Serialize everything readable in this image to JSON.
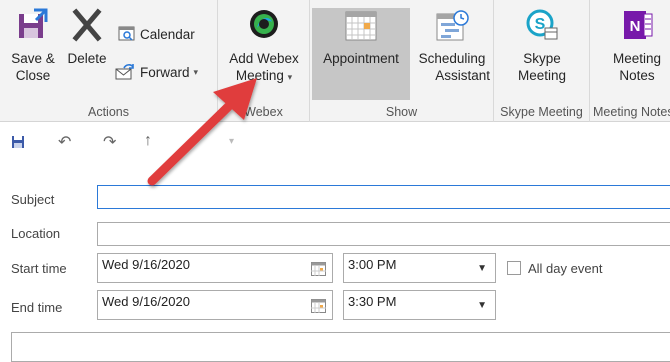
{
  "ribbon": {
    "actions": {
      "group_label": "Actions",
      "save_close_line1": "Save &",
      "save_close_line2": "Close",
      "delete_label": "Delete",
      "calendar_label": "Calendar",
      "forward_label": "Forward"
    },
    "webex": {
      "group_label": "Webex",
      "add_webex_line1": "Add Webex",
      "add_webex_line2": "Meeting"
    },
    "show": {
      "group_label": "Show",
      "appointment_label": "Appointment",
      "scheduling_line1": "Scheduling",
      "scheduling_line2": "Assistant"
    },
    "skype": {
      "group_label": "Skype Meeting",
      "skype_line1": "Skype",
      "skype_line2": "Meeting"
    },
    "notes": {
      "group_label": "Meeting Notes",
      "notes_line1": "Meeting",
      "notes_line2": "Notes"
    }
  },
  "form": {
    "subject_label": "Subject",
    "subject_value": "",
    "location_label": "Location",
    "location_value": "",
    "start_time_label": "Start time",
    "start_date": "Wed 9/16/2020",
    "start_time": "3:00 PM",
    "all_day_label": "All day event",
    "end_time_label": "End time",
    "end_date": "Wed 9/16/2020",
    "end_time": "3:30 PM"
  },
  "colors": {
    "accent_blue": "#2b79d8",
    "arrow_red": "#e03c3c",
    "ribbon_bg": "#f3f3f3",
    "onenote_purple": "#7719aa",
    "skype_teal": "#1aa3c8"
  }
}
